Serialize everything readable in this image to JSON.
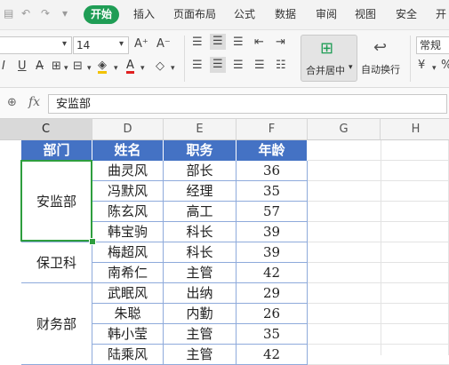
{
  "menu": {
    "items": [
      "开始",
      "插入",
      "页面布局",
      "公式",
      "数据",
      "审阅",
      "视图",
      "安全",
      "开"
    ]
  },
  "ribbon": {
    "font_size": "14",
    "number_format": "常规",
    "merge_center_label": "合并居中",
    "wrap_text_label": "自动换行",
    "bold_icon": "B",
    "italic_icon": "I",
    "underline_icon": "U",
    "font_color_icon": "A",
    "grow_icon": "A⁺",
    "shrink_icon": "A⁻"
  },
  "formula_bar": {
    "fx_label": "fx",
    "value": "安监部"
  },
  "columns": [
    "C",
    "D",
    "E",
    "F",
    "G",
    "H"
  ],
  "table": {
    "headers": [
      "部门",
      "姓名",
      "职务",
      "年龄"
    ],
    "departments": [
      {
        "name": "安监部",
        "rows": 4
      },
      {
        "name": "保卫科",
        "rows": 2
      },
      {
        "name": "财务部",
        "rows": 4
      }
    ],
    "rows": [
      [
        "曲灵风",
        "部长",
        "36"
      ],
      [
        "冯默风",
        "经理",
        "35"
      ],
      [
        "陈玄风",
        "高工",
        "57"
      ],
      [
        "韩宝驹",
        "科长",
        "39"
      ],
      [
        "梅超风",
        "科长",
        "39"
      ],
      [
        "南希仁",
        "主管",
        "42"
      ],
      [
        "武眠风",
        "出纳",
        "29"
      ],
      [
        "朱聪",
        "内勤",
        "26"
      ],
      [
        "韩小莹",
        "主管",
        "35"
      ],
      [
        "陆乘风",
        "主管",
        "42"
      ]
    ]
  },
  "colors": {
    "header_fill": "#4472c4",
    "accent_green": "#1f9d55",
    "selection_border": "#2e9e3e"
  }
}
